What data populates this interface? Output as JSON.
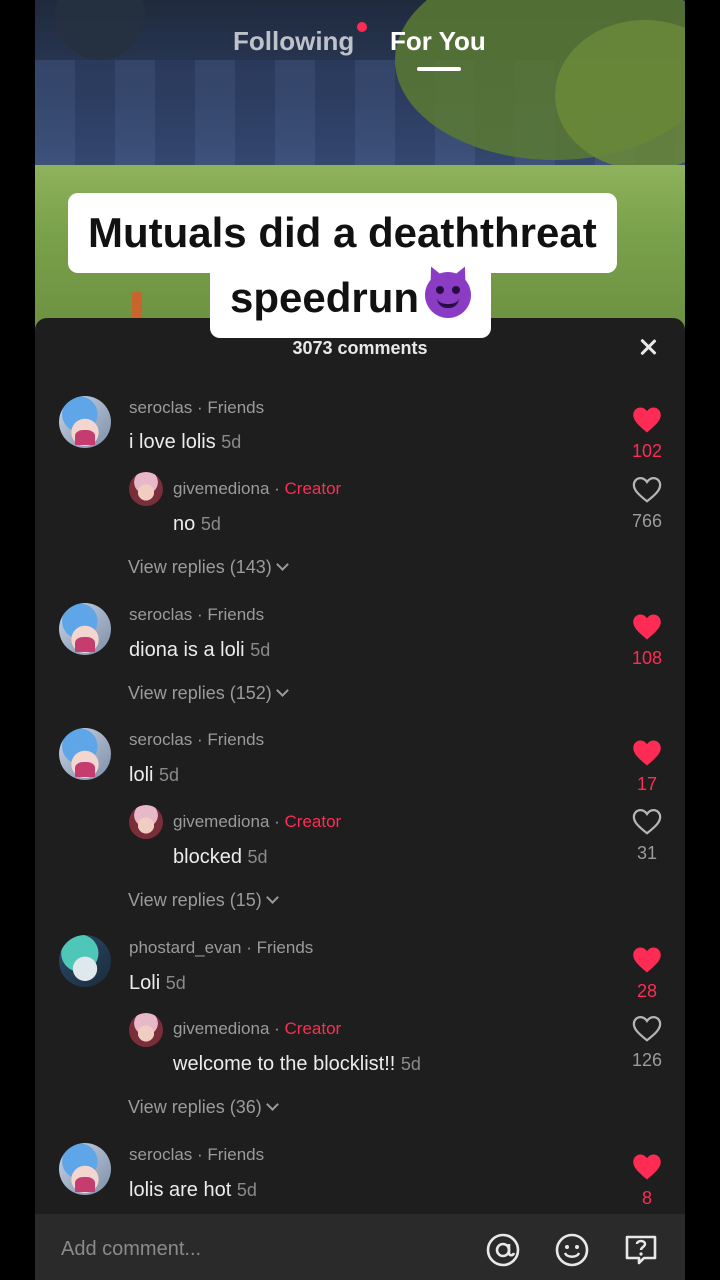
{
  "tabs": {
    "following": "Following",
    "for_you": "For You"
  },
  "caption": {
    "line1": "Mutuals did a deaththreat",
    "line2": "speedrun"
  },
  "comments_header": {
    "count_label": "3073 comments"
  },
  "comments": [
    {
      "user": "seroclas",
      "tag": "Friends",
      "text": "i love lolis",
      "age": "5d",
      "likes": "102",
      "liked": true,
      "reply": {
        "user": "givemediona",
        "tag": "Creator",
        "text": "no",
        "age": "5d",
        "likes": "766",
        "liked": false
      },
      "view_replies": "View replies (143)"
    },
    {
      "user": "seroclas",
      "tag": "Friends",
      "text": "diona is a loli",
      "age": "5d",
      "likes": "108",
      "liked": true,
      "view_replies": "View replies (152)"
    },
    {
      "user": "seroclas",
      "tag": "Friends",
      "text": "loli",
      "age": "5d",
      "likes": "17",
      "liked": true,
      "reply": {
        "user": "givemediona",
        "tag": "Creator",
        "text": "blocked",
        "age": "5d",
        "likes": "31",
        "liked": false
      },
      "view_replies": "View replies (15)"
    },
    {
      "user": "phostard_evan",
      "tag": "Friends",
      "text": "Loli",
      "age": "5d",
      "likes": "28",
      "liked": true,
      "reply": {
        "user": "givemediona",
        "tag": "Creator",
        "text": "welcome to the blocklist!!",
        "age": "5d",
        "likes": "126",
        "liked": false
      },
      "view_replies": "View replies (36)"
    },
    {
      "user": "seroclas",
      "tag": "Friends",
      "text": "lolis are hot",
      "age": "5d",
      "likes": "8",
      "liked": true
    }
  ],
  "input": {
    "placeholder": "Add comment..."
  },
  "icons": {
    "close": "close-icon",
    "mention": "at-sign-icon",
    "emoji": "emoji-icon",
    "question": "question-icon",
    "like": "heart-icon"
  },
  "colors": {
    "accent": "#fe2c55",
    "sheet": "#1e1e1e",
    "bar": "#2a2a2a"
  }
}
